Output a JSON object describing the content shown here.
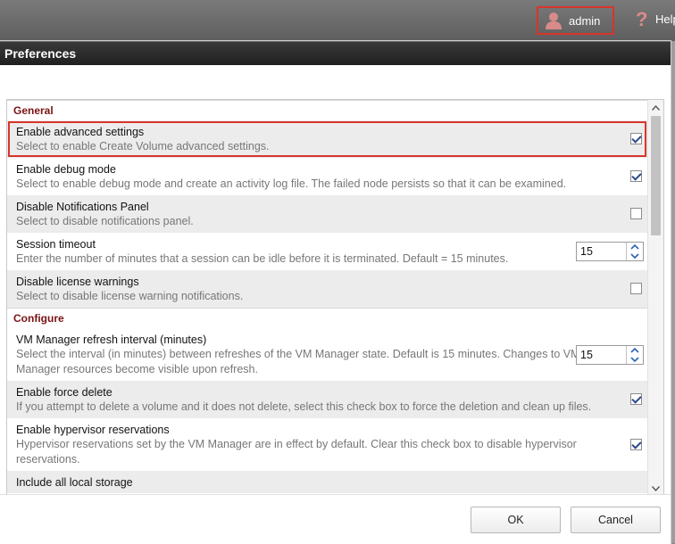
{
  "topbar": {
    "user": "admin",
    "help": "Help"
  },
  "dialog": {
    "title": "Preferences",
    "sections": [
      {
        "header": "General",
        "rows": [
          {
            "title": "Enable advanced settings",
            "desc": "Select to enable Create Volume advanced settings.",
            "control": "checkbox",
            "checked": true
          },
          {
            "title": "Enable debug mode",
            "desc": "Select to enable debug mode and create an activity log file. The failed node persists so that it can be examined.",
            "control": "checkbox",
            "checked": true
          },
          {
            "title": "Disable Notifications Panel",
            "desc": "Select to disable notifications panel.",
            "control": "checkbox",
            "checked": false
          },
          {
            "title": "Session timeout",
            "desc": "Enter the number of minutes that a session can be idle before it is terminated. Default = 15 minutes.",
            "control": "spinner",
            "value": "15"
          },
          {
            "title": "Disable license warnings",
            "desc": "Select to disable license warning notifications.",
            "control": "checkbox",
            "checked": false
          }
        ]
      },
      {
        "header": "Configure",
        "rows": [
          {
            "title": "VM Manager refresh interval (minutes)",
            "desc": "Select the interval (in minutes) between refreshes of the VM Manager state. Default is 15 minutes. Changes to VM Manager resources become visible upon refresh.",
            "control": "spinner",
            "value": "15"
          },
          {
            "title": "Enable force delete",
            "desc": "If you attempt to delete a volume and it does not delete, select this check box to force the deletion and clean up files.",
            "control": "checkbox",
            "checked": true
          },
          {
            "title": "Enable hypervisor reservations",
            "desc": "Hypervisor reservations set by the VM Manager are in effect by default. Clear this check box to disable hypervisor reservations.",
            "control": "checkbox",
            "checked": true
          },
          {
            "title": "Include all local storage",
            "desc": "",
            "control": "none"
          }
        ]
      }
    ],
    "ok_label": "OK",
    "cancel_label": "Cancel"
  },
  "colors": {
    "highlight": "#d9342b",
    "section_header": "#7a1313"
  }
}
